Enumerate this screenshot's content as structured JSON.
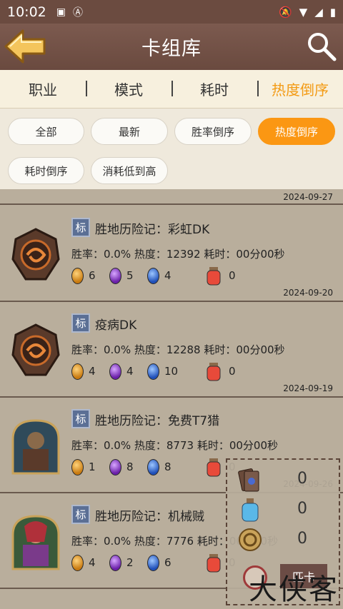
{
  "status": {
    "time": "10:02"
  },
  "header": {
    "title": "卡组库"
  },
  "tabs": [
    {
      "label": "职业"
    },
    {
      "label": "模式"
    },
    {
      "label": "耗时"
    },
    {
      "label": "热度倒序",
      "active": true
    }
  ],
  "filters": [
    {
      "label": "全部"
    },
    {
      "label": "最新"
    },
    {
      "label": "胜率倒序"
    },
    {
      "label": "热度倒序",
      "active": true
    },
    {
      "label": "耗时倒序"
    },
    {
      "label": "消耗低到高"
    }
  ],
  "top_row": {
    "date": "2024-09-27"
  },
  "decks": [
    {
      "badge": "标",
      "name": "胜地历险记：彩虹DK",
      "stats": "胜率：0.0%  热度：12392  耗时：00分00秒",
      "costs": [
        "6",
        "5",
        "4",
        "0"
      ],
      "date": "2024-09-20",
      "hero": "dk-icon"
    },
    {
      "badge": "标",
      "name": "疫病DK",
      "stats": "胜率：0.0%  热度：12288  耗时：00分00秒",
      "costs": [
        "4",
        "4",
        "10",
        "0"
      ],
      "date": "2024-09-19",
      "hero": "dk-icon"
    },
    {
      "badge": "标",
      "name": "胜地历险记：免费T7猎",
      "stats": "胜率：0.0%  热度：8773  耗时：00分00秒",
      "costs": [
        "1",
        "8",
        "8",
        "0"
      ],
      "date": "2024-09-26",
      "hero": "hunter-portrait"
    },
    {
      "badge": "标",
      "name": "胜地历险记：机械贼",
      "stats": "胜率：0.0%  热度：7776  耗时：00分00秒",
      "costs": [
        "4",
        "2",
        "6",
        "0"
      ],
      "date": "",
      "hero": "rogue-portrait"
    }
  ],
  "dust_panel": {
    "rows": [
      {
        "value": "0"
      },
      {
        "value": "0"
      },
      {
        "value": "0"
      }
    ],
    "button_label": "匹卡"
  },
  "watermark": "大侠客"
}
